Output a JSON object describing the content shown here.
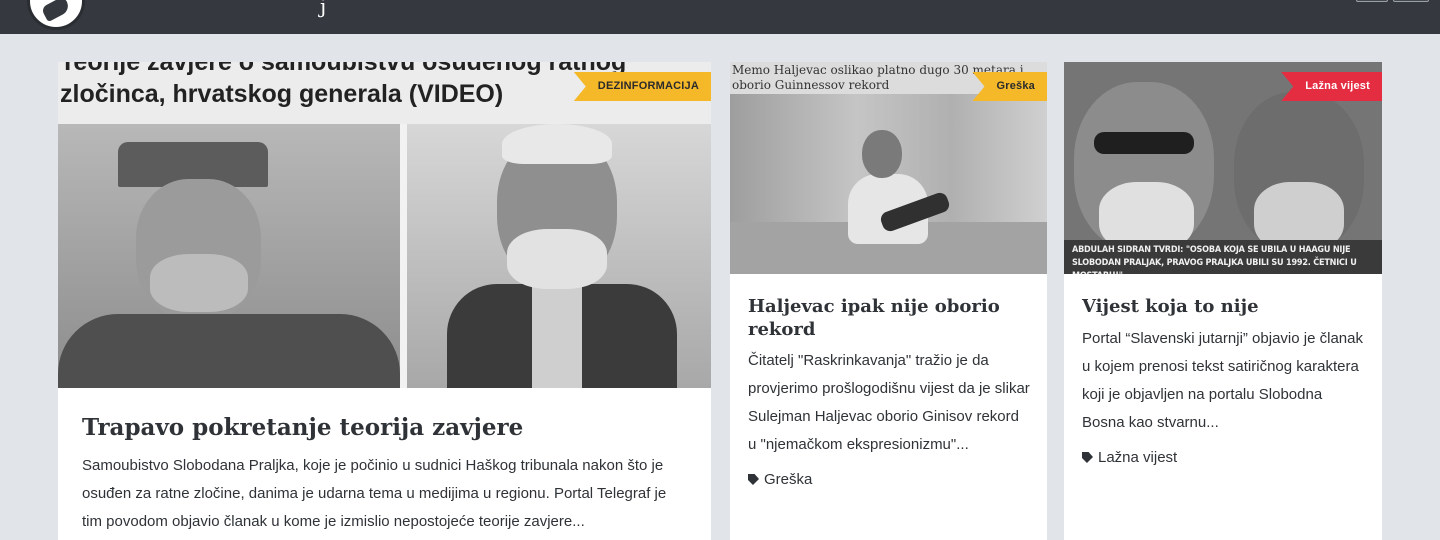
{
  "header": {
    "brand_fragment": "j",
    "logo_icon": "hand-logo-icon"
  },
  "cards": [
    {
      "tag": "DEZINFORMACIJA",
      "tag_color": "#f4b829",
      "image_headline_line1": "Teorije zavjere o samoubistvu osuđenog ratnog",
      "image_headline_line2": "zločinca, hrvatskog generala (VIDEO)",
      "title": "Trapavo pokretanje teorija zavjere",
      "description": "Samoubistvo Slobodana Praljka, koje je počinio u sudnici Haškog tribunala nakon što je osuđen za ratne zločine, danima je udarna tema u medijima u regionu. Portal Telegraf je tim povodom objavio članak u kome je izmislio nepostojeće teorije zavjere..."
    },
    {
      "tag": "Greška",
      "tag_color": "#f4b829",
      "image_caption": "Memo Haljevac oslikao platno dugo 30 metara i oborio Guinnessov rekord",
      "title": "Haljevac ipak nije oborio rekord",
      "description": "Čitatelj \"Raskrinkavanja\" tražio je da provjerimo prošlogodišnu vijest da je slikar Sulejman Haljevac oborio Ginisov rekord u \"njemačkom ekspresionizmu\"...",
      "category": "Greška",
      "category_icon": "tag-icon"
    },
    {
      "tag": "Lažna vijest",
      "tag_color": "#e52d42",
      "image_quote": "ABDULAH SIDRAN TVRDI: \"OSOBA KOJA SE UBILA U HAAGU NIJE SLOBODAN PRALJAK, PRAVOG PRALJKA UBILI SU 1992. ČETNICI U MOSTARU!\"",
      "title": "Vijest koja to nije",
      "description": "Portal “Slavenski jutarnji” objavio je članak u kojem prenosi tekst satiričnog karaktera koji je objavljen na portalu Slobodna Bosna kao stvarnu...",
      "category": "Lažna vijest",
      "category_icon": "tag-icon"
    }
  ]
}
